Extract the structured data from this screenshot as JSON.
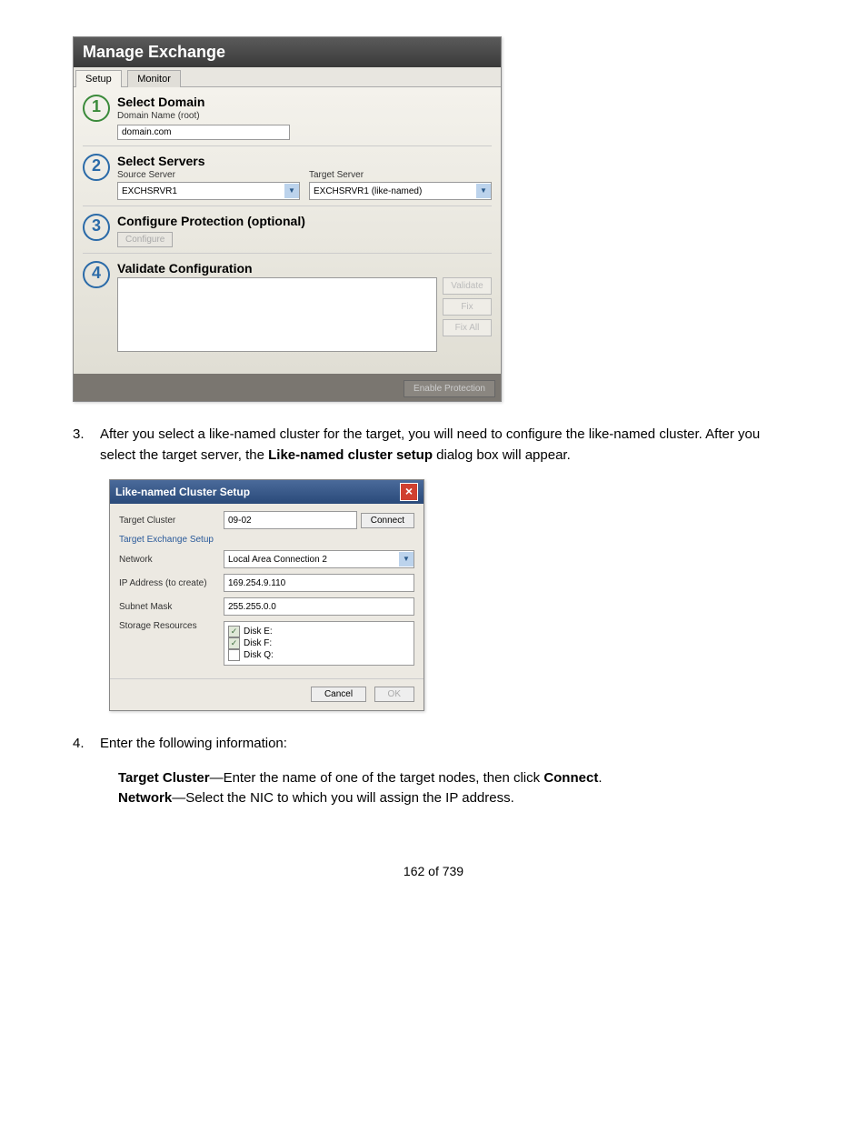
{
  "wizard": {
    "title": "Manage Exchange",
    "tabs": {
      "setup": "Setup",
      "monitor": "Monitor"
    },
    "step1": {
      "title": "Select Domain",
      "sub": "Domain Name (root)",
      "value": "domain.com"
    },
    "step2": {
      "title": "Select Servers",
      "sourceLabel": "Source Server",
      "sourceValue": "EXCHSRVR1",
      "targetLabel": "Target Server",
      "targetValue": "EXCHSRVR1 (like-named)"
    },
    "step3": {
      "title": "Configure Protection (optional)",
      "btn": "Configure"
    },
    "step4": {
      "title": "Validate Configuration",
      "validate": "Validate",
      "fix": "Fix",
      "fixall": "Fix All"
    },
    "footer": "Enable Protection"
  },
  "doc": {
    "item3_num": "3.",
    "item3_a": "After you select a like-named cluster for the target, you will need to configure the like-named cluster. After you select the target server, the ",
    "item3_b": "Like-named cluster setup",
    "item3_c": " dialog box will appear.",
    "item4_num": "4.",
    "item4_text": "Enter the following information:",
    "sub_tc_bold": "Target Cluster",
    "sub_tc_rest": "—Enter the name of one of the target nodes, then click ",
    "sub_tc_connect": "Connect",
    "sub_tc_end": ".",
    "sub_net_bold": "Network",
    "sub_net_rest": "—Select the NIC to which you will assign the IP address."
  },
  "dialog": {
    "title": "Like-named Cluster Setup",
    "targetClusterLabel": "Target Cluster",
    "targetClusterValue": "09-02",
    "connect": "Connect",
    "groupLabel": "Target Exchange Setup",
    "networkLabel": "Network",
    "networkValue": "Local Area Connection 2",
    "ipLabel": "IP Address (to create)",
    "ipValue": "169.254.9.110",
    "subnetLabel": "Subnet Mask",
    "subnetValue": "255.255.0.0",
    "storageLabel": "Storage Resources",
    "diskE": "Disk E:",
    "diskF": "Disk F:",
    "diskQ": "Disk Q:",
    "cancel": "Cancel",
    "ok": "OK"
  },
  "page": "162 of 739"
}
